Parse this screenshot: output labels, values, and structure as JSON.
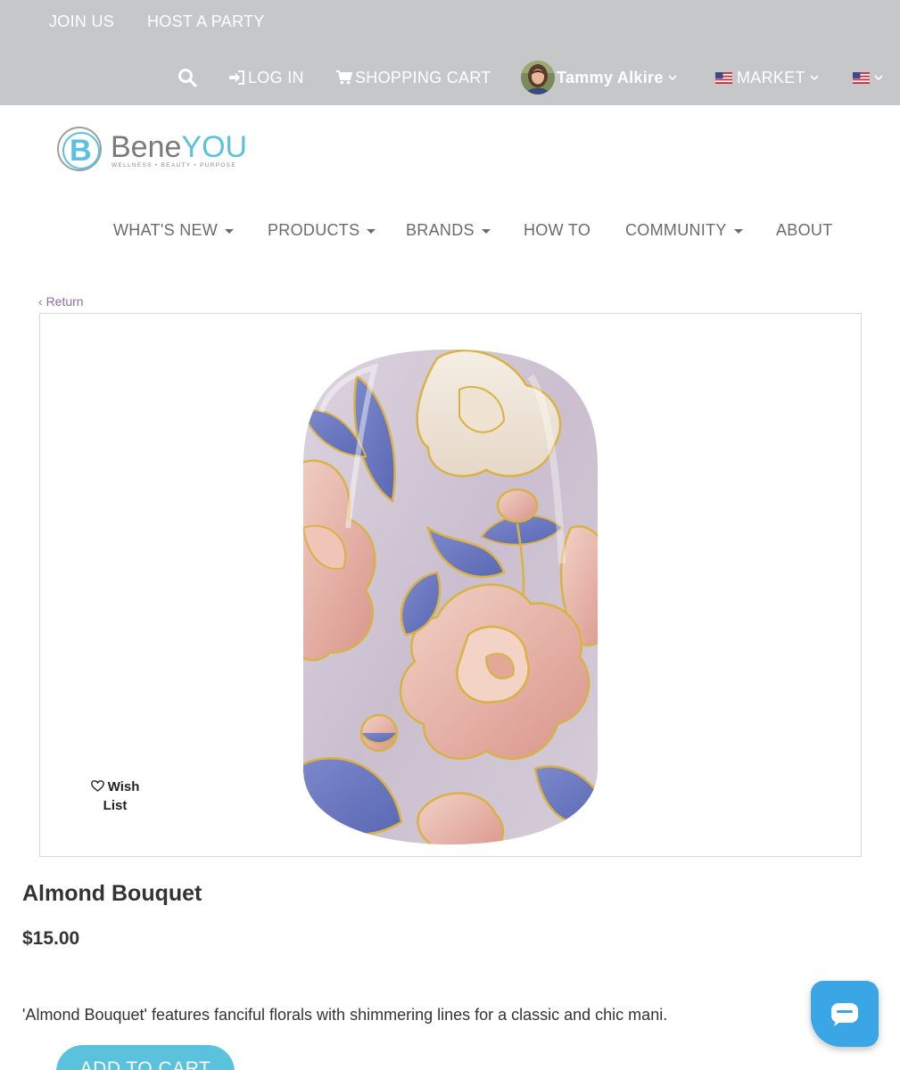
{
  "topbar": {
    "join_us": "JOIN US",
    "host_party": "HOST A PARTY",
    "login": "LOG IN",
    "cart": "SHOPPING CART",
    "user_name": "Tammy Alkire",
    "market": "MARKET"
  },
  "brand": {
    "logo_letter": "B",
    "name_part1": "Bene",
    "name_part2": "YOU",
    "tagline": "WELLNESS • BEAUTY • PURPOSE"
  },
  "nav": {
    "whats_new": "WHAT'S NEW",
    "products": "PRODUCTS",
    "brands": "BRANDS",
    "how_to": "HOW TO",
    "community": "COMMUNITY",
    "about": "ABOUT"
  },
  "product": {
    "return_label": "Return",
    "wish_list_line1": "Wish",
    "wish_list_line2": "List",
    "name": "Almond Bouquet",
    "price": "$15.00",
    "description": "'Almond Bouquet' features fanciful florals with shimmering lines for a classic and chic mani.",
    "add_to_cart": "ADD TO CART"
  },
  "colors": {
    "topbar_bg": "#c6c7c9",
    "accent": "#5bc2dd",
    "chat": "#3aa6e6",
    "nail_base": "#cfc4d3",
    "petal": "#e9b4a6",
    "leaf": "#6d7bc0",
    "gold": "#d9b245"
  },
  "icons": {
    "search": "search-icon",
    "login": "sign-in-icon",
    "cart": "shopping-cart-icon",
    "flag": "us-flag-icon",
    "wish": "heart-outline-icon",
    "chat": "chat-bubble-icon"
  }
}
